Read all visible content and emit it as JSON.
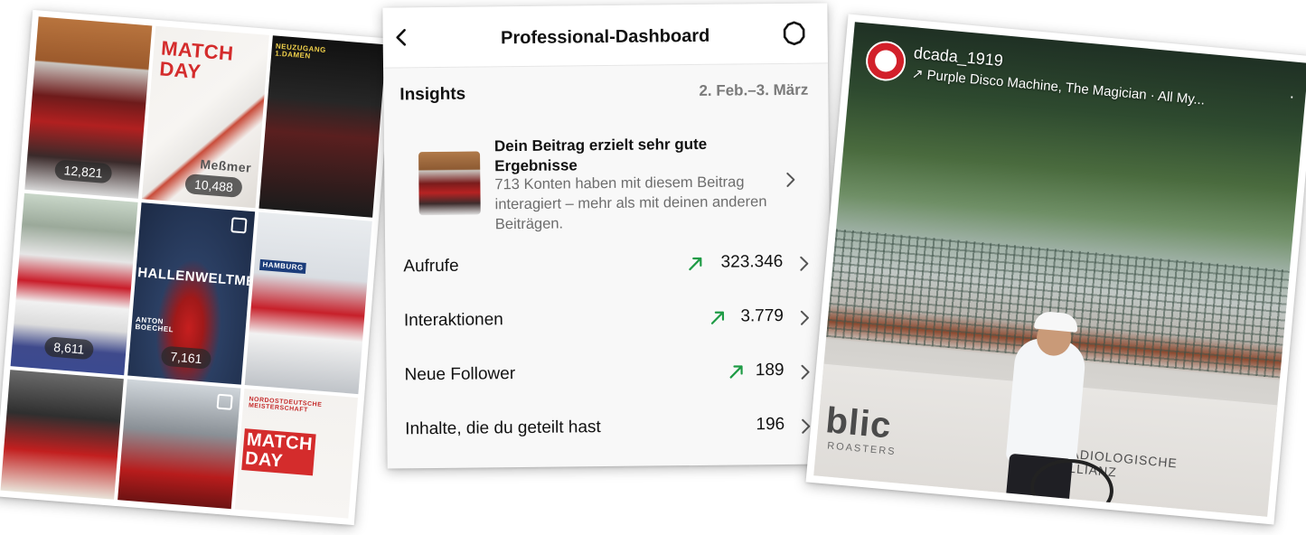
{
  "grid": {
    "tiles": [
      {
        "count": "12,821",
        "text": ""
      },
      {
        "count": "10,488",
        "text": "MATCH\nDAY",
        "small": "Meßmer"
      },
      {
        "count": "",
        "text": "NEUZUGANG\n1.DAMEN"
      },
      {
        "count": "8,611",
        "text": ""
      },
      {
        "count": "7,161",
        "text": "HALLENWELTMEISTER",
        "small": "ANTON BOECHEL"
      },
      {
        "count": "",
        "text": "HAMBURG"
      },
      {
        "count": "",
        "text": ""
      },
      {
        "count": "",
        "text": ""
      },
      {
        "count": "",
        "text": "MATCH\nDAY",
        "small": "NORDOSTDEUTSCHE MEISTERSCHAFT"
      }
    ]
  },
  "dashboard": {
    "title": "Professional-Dashboard",
    "insights_label": "Insights",
    "date_range": "2. Feb.–3. März",
    "post": {
      "headline": "Dein Beitrag erzielt sehr gute Ergebnisse",
      "description": "713 Konten haben mit diesem Beitrag interagiert – mehr als mit deinen anderen Beiträgen."
    },
    "metrics": [
      {
        "label": "Aufrufe",
        "value": "323.346",
        "trend": true
      },
      {
        "label": "Interaktionen",
        "value": "3.779",
        "trend": true
      },
      {
        "label": "Neue Follower",
        "value": "189",
        "trend": true
      },
      {
        "label": "Inhalte, die du geteilt hast",
        "value": "196",
        "trend": false
      }
    ],
    "colors": {
      "trend": "#1e9b45",
      "text": "#111111",
      "muted": "#6d6d6d"
    }
  },
  "story": {
    "username": "dcada_1919",
    "music": "↗ Purple Disco Machine, The Magician · All My...",
    "banner_word": "blic",
    "banner_sub": "ROASTERS",
    "banner_right": "RADIOLOGISCHE\nALLIANZ"
  }
}
